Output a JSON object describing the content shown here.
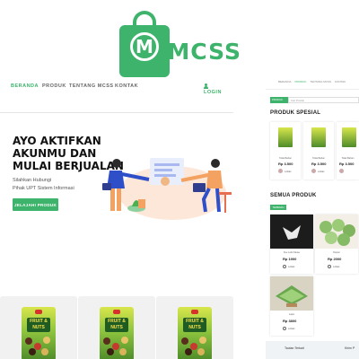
{
  "brand": {
    "logo_letter": "M",
    "name": "MCSS"
  },
  "nav": {
    "items": [
      "BERANDA",
      "PRODUK",
      "TENTANG MCSS",
      "KONTAK"
    ],
    "login": "LOGIN"
  },
  "hero": {
    "title_lines": [
      "AYO AKTIFKAN",
      "AKUNMU DAN",
      "MULAI BERJUALAN"
    ],
    "subtitle_lines": [
      "Silahkan Hubungi",
      "Pihak UPT Sistem Informasi"
    ],
    "button": "JELAJAHI PRODUK"
  },
  "product_cards": [
    {
      "pack_label": "FRUIT & NUTS"
    },
    {
      "pack_label": "FRUIT & NUTS"
    },
    {
      "pack_label": "FRUIT & NUTS"
    }
  ],
  "pane": {
    "nav": [
      "BERANDA",
      "PRODUK",
      "TENTANG MCSS",
      "KONTAK"
    ],
    "select": "PRODUK",
    "search_placeholder": "Cari Produk",
    "special_title": "PRODUK SPESIAL",
    "special_items": [
      {
        "name": "Tolak Bahan",
        "price": "Rp 3.500",
        "seller": "Lobaki"
      },
      {
        "name": "Tolak Bahan",
        "price": "Rp 3.500",
        "seller": "Lobaki"
      },
      {
        "name": "Tolak Bahan",
        "price": "Rp 3.500",
        "seller": ""
      }
    ],
    "all_title": "SEMUA PRODUK",
    "filter_button": "TERBARU",
    "all_items": [
      {
        "name": "Kue Lobo Mewe",
        "price": "Rp 1900",
        "seller": "Lobaki"
      },
      {
        "name": "Klepon",
        "price": "Rp 2000",
        "seller": "Lobaki"
      },
      {
        "name": "Lapis",
        "price": "Rp 3800",
        "seller": "Lobaki"
      }
    ],
    "footer": {
      "left": "Tautan Terkait",
      "right": "Kirim P"
    }
  }
}
